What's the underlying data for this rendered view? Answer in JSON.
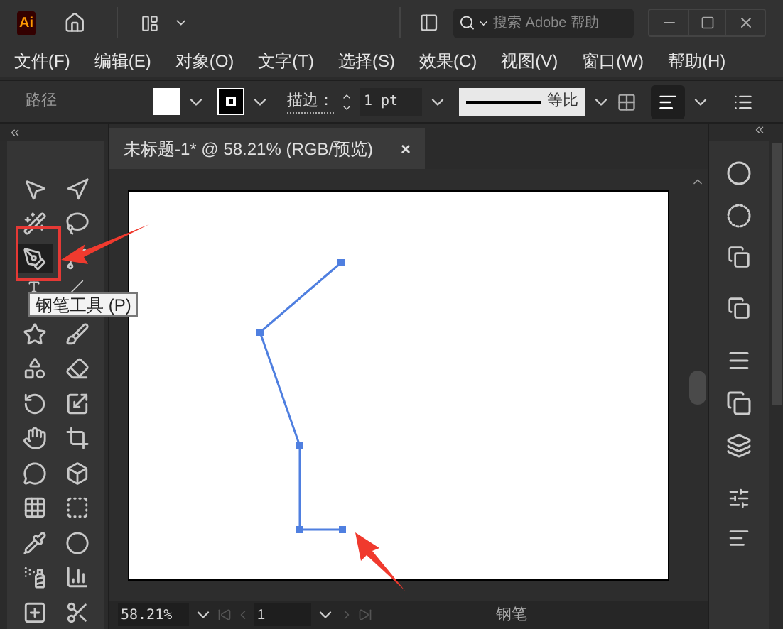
{
  "window": {
    "app_badge": "Ai",
    "search": {
      "placeholder": "搜索 Adobe 帮助"
    }
  },
  "menu": [
    "文件(F)",
    "编辑(E)",
    "对象(O)",
    "文字(T)",
    "选择(S)",
    "效果(C)",
    "视图(V)",
    "窗口(W)",
    "帮助(H)"
  ],
  "control_bar": {
    "selection_label": "路径",
    "stroke_label": "描边：",
    "stroke_weight": "1 pt",
    "stroke_profile": "等比"
  },
  "document_tab": {
    "title": "未标题-1* @ 58.21% (RGB/预览)",
    "close": "×"
  },
  "tools": [
    {
      "selected": false
    },
    {
      "selected": false
    },
    {
      "selected": false
    },
    {
      "selected": false
    },
    {
      "selected": true
    },
    {
      "selected": false
    },
    {
      "selected": false,
      "covered": true
    },
    {
      "selected": false,
      "covered": true
    },
    {
      "selected": false
    },
    {
      "selected": false
    },
    {
      "selected": false
    },
    {
      "selected": false
    },
    {
      "selected": false
    },
    {
      "selected": false
    },
    {
      "selected": false
    },
    {
      "selected": false
    },
    {
      "selected": false
    },
    {
      "selected": false
    },
    {
      "selected": false
    },
    {
      "selected": false
    },
    {
      "selected": false
    },
    {
      "selected": false
    },
    {
      "selected": false
    },
    {
      "selected": false
    },
    {
      "selected": false
    },
    {
      "selected": false
    }
  ],
  "tooltip": "钢笔工具 (P)",
  "status_bar": {
    "zoom": "58.21%",
    "artboard": "1",
    "current_tool": "钢笔"
  }
}
